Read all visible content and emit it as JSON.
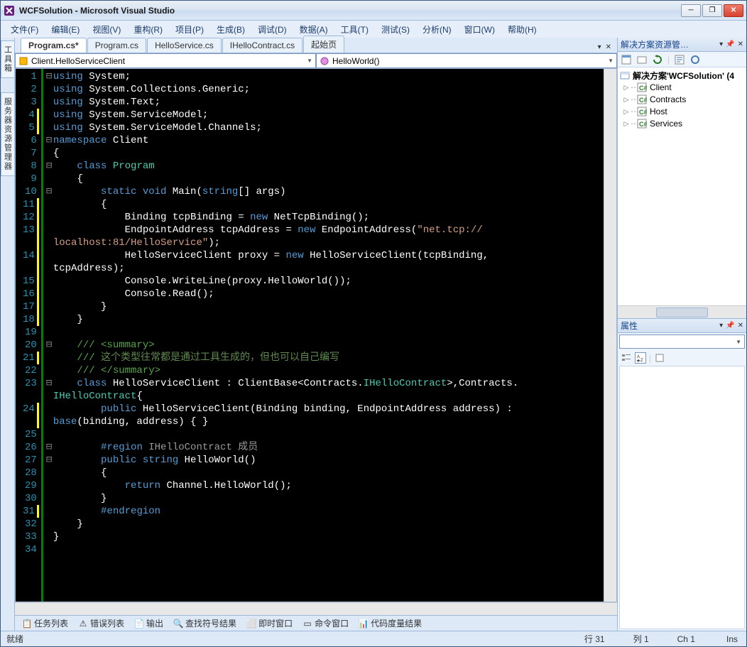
{
  "title": "WCFSolution - Microsoft Visual Studio",
  "menu": [
    "文件(F)",
    "编辑(E)",
    "视图(V)",
    "重构(R)",
    "项目(P)",
    "生成(B)",
    "调试(D)",
    "数据(A)",
    "工具(T)",
    "测试(S)",
    "分析(N)",
    "窗口(W)",
    "帮助(H)"
  ],
  "leftTabs": [
    "工具箱",
    "服务器资源管理器"
  ],
  "tabs": [
    {
      "label": "Program.cs*",
      "active": true
    },
    {
      "label": "Program.cs",
      "active": false
    },
    {
      "label": "HelloService.cs",
      "active": false
    },
    {
      "label": "IHelloContract.cs",
      "active": false
    },
    {
      "label": "起始页",
      "active": false
    }
  ],
  "navLeft": "Client.HelloServiceClient",
  "navRight": "HelloWorld()",
  "code": {
    "lines": [
      {
        "n": 1,
        "fold": "-",
        "html": "<span class='kw'>using</span> System;"
      },
      {
        "n": 2,
        "fold": " ",
        "html": "<span class='kw'>using</span> System.Collections.Generic;"
      },
      {
        "n": 3,
        "fold": " ",
        "html": "<span class='kw'>using</span> System.Text;"
      },
      {
        "n": 4,
        "fold": " ",
        "y": true,
        "html": "<span class='kw'>using</span> System.ServiceModel;"
      },
      {
        "n": 5,
        "fold": " ",
        "y": true,
        "html": "<span class='kw'>using</span> System.ServiceModel.Channels;"
      },
      {
        "n": 6,
        "fold": "-",
        "html": "<span class='kw'>namespace</span> Client"
      },
      {
        "n": 7,
        "fold": " ",
        "html": "{"
      },
      {
        "n": 8,
        "fold": "-",
        "html": "    <span class='kw'>class</span> <span class='type'>Program</span>"
      },
      {
        "n": 9,
        "fold": " ",
        "html": "    {"
      },
      {
        "n": 10,
        "fold": "-",
        "html": "        <span class='kw'>static void</span> Main(<span class='kw'>string</span>[] args)"
      },
      {
        "n": 11,
        "fold": " ",
        "y": true,
        "html": "        {"
      },
      {
        "n": 12,
        "fold": " ",
        "y": true,
        "html": "            Binding tcpBinding = <span class='kw'>new</span> NetTcpBinding();"
      },
      {
        "n": 13,
        "fold": " ",
        "y": true,
        "html": "            EndpointAddress tcpAddress = <span class='kw'>new</span> EndpointAddress(<span class='str'>\"net.tcp://</span>"
      },
      {
        "n": "",
        "fold": " ",
        "y": true,
        "html": "<span class='str'>localhost:81/HelloService\"</span>);"
      },
      {
        "n": 14,
        "fold": " ",
        "y": true,
        "html": "            HelloServiceClient proxy = <span class='kw'>new</span> HelloServiceClient(tcpBinding, "
      },
      {
        "n": "",
        "fold": " ",
        "y": true,
        "html": "tcpAddress);"
      },
      {
        "n": 15,
        "fold": " ",
        "y": true,
        "html": "            Console.WriteLine(proxy.HelloWorld());"
      },
      {
        "n": 16,
        "fold": " ",
        "y": true,
        "html": "            Console.Read();"
      },
      {
        "n": 17,
        "fold": " ",
        "y": true,
        "html": "        }"
      },
      {
        "n": 18,
        "fold": " ",
        "y": true,
        "html": "    }"
      },
      {
        "n": 19,
        "fold": " ",
        "html": ""
      },
      {
        "n": 20,
        "fold": "-",
        "html": "    <span class='cmt'>/// &lt;summary&gt;</span>"
      },
      {
        "n": 21,
        "fold": " ",
        "y": true,
        "html": "    <span class='cmt'>///</span> <span class='cmt2'>这个类型往常都是通过工具生成的，但也可以自己编写</span>"
      },
      {
        "n": 22,
        "fold": " ",
        "html": "    <span class='cmt'>/// &lt;/summary&gt;</span>"
      },
      {
        "n": 23,
        "fold": "-",
        "html": "    <span class='kw'>class</span> HelloServiceClient : ClientBase&lt;Contracts.<span class='type'>IHelloContract</span>&gt;,Contracts."
      },
      {
        "n": "",
        "fold": " ",
        "html": "<span class='type'>IHelloContract</span>{"
      },
      {
        "n": 24,
        "fold": " ",
        "y": true,
        "html": "        <span class='kw'>public</span> HelloServiceClient(Binding binding, EndpointAddress address) : "
      },
      {
        "n": "",
        "fold": " ",
        "y": true,
        "html": "<span class='kw'>base</span>(binding, address) { }"
      },
      {
        "n": 25,
        "fold": " ",
        "html": ""
      },
      {
        "n": 26,
        "fold": "-",
        "html": "        <span class='kw'>#region</span><span class='region'> IHelloContract 成员</span>"
      },
      {
        "n": 27,
        "fold": "-",
        "html": "        <span class='kw'>public string</span> HelloWorld()"
      },
      {
        "n": 28,
        "fold": " ",
        "html": "        {"
      },
      {
        "n": 29,
        "fold": " ",
        "html": "            <span class='kw'>return</span> Channel.HelloWorld();"
      },
      {
        "n": 30,
        "fold": " ",
        "html": "        }"
      },
      {
        "n": 31,
        "fold": " ",
        "y": true,
        "html": "        <span class='kw'>#endregion</span>"
      },
      {
        "n": 32,
        "fold": " ",
        "html": "    }"
      },
      {
        "n": 33,
        "fold": " ",
        "html": "}"
      },
      {
        "n": 34,
        "fold": " ",
        "html": ""
      }
    ]
  },
  "bottomTabs": [
    "任务列表",
    "错误列表",
    "输出",
    "查找符号结果",
    "即时窗口",
    "命令窗口",
    "代码度量结果"
  ],
  "solutionExplorer": {
    "title": "解决方案资源管…",
    "root": "解决方案'WCFSolution' (4",
    "projects": [
      "Client",
      "Contracts",
      "Host",
      "Services"
    ]
  },
  "properties": {
    "title": "属性"
  },
  "status": {
    "ready": "就绪",
    "line": "行 31",
    "col": "列 1",
    "ch": "Ch 1",
    "ins": "Ins"
  }
}
